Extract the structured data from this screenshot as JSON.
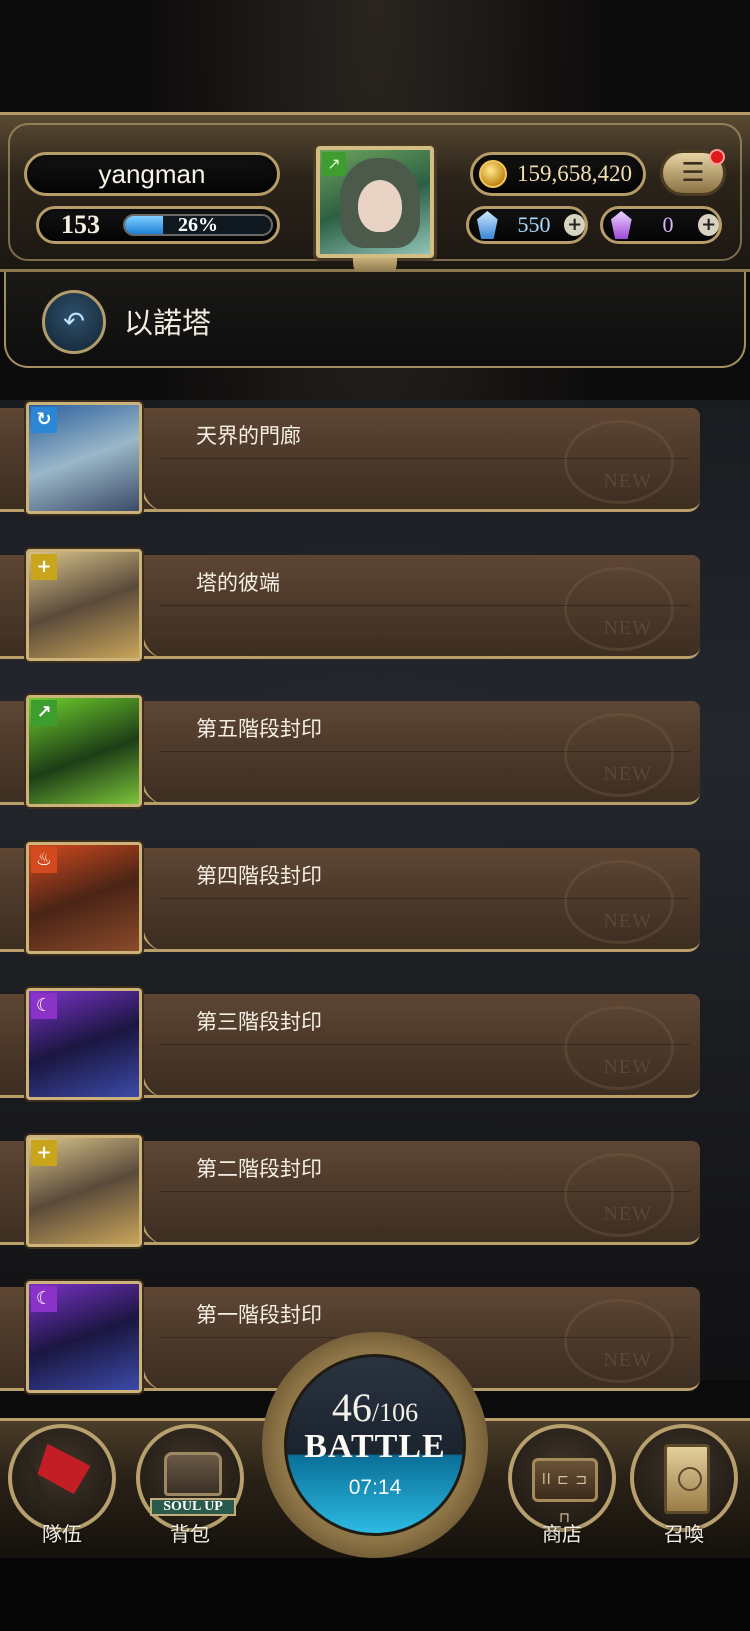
{
  "player": {
    "name": "yangman",
    "level": "153",
    "exp_percent_label": "26%",
    "exp_fraction": 0.26,
    "element_icon": "wind-icon"
  },
  "currency": {
    "gold": "159,658,420",
    "blue_gems": "550",
    "purple_gems": "0"
  },
  "page": {
    "title": "以諾塔"
  },
  "stages": [
    {
      "label": "天界的門廊",
      "element": "water",
      "element_symbol": "↻",
      "element_color": "#2c86d6"
    },
    {
      "label": "塔的彼端",
      "element": "light",
      "element_symbol": "+",
      "element_color": "#c9a51c"
    },
    {
      "label": "第五階段封印",
      "element": "wind",
      "element_symbol": "↗",
      "element_color": "#3e9d2f"
    },
    {
      "label": "第四階段封印",
      "element": "fire",
      "element_symbol": "♨",
      "element_color": "#d24a1e"
    },
    {
      "label": "第三階段封印",
      "element": "dark",
      "element_symbol": "☾",
      "element_color": "#8b33c8"
    },
    {
      "label": "第二階段封印",
      "element": "light",
      "element_symbol": "+",
      "element_color": "#c9a51c"
    },
    {
      "label": "第一階段封印",
      "element": "dark",
      "element_symbol": "☾",
      "element_color": "#8b33c8"
    }
  ],
  "stage_badge": "NEW",
  "battle": {
    "current": "46",
    "max": "/106",
    "label": "BATTLE",
    "timer": "07:14"
  },
  "nav": {
    "team": "隊伍",
    "bag": "背包",
    "bag_tag": "SOUL UP",
    "shop": "商店",
    "shop_sign": "ll ⊏ ⊐ ⊓",
    "summon": "召喚"
  }
}
